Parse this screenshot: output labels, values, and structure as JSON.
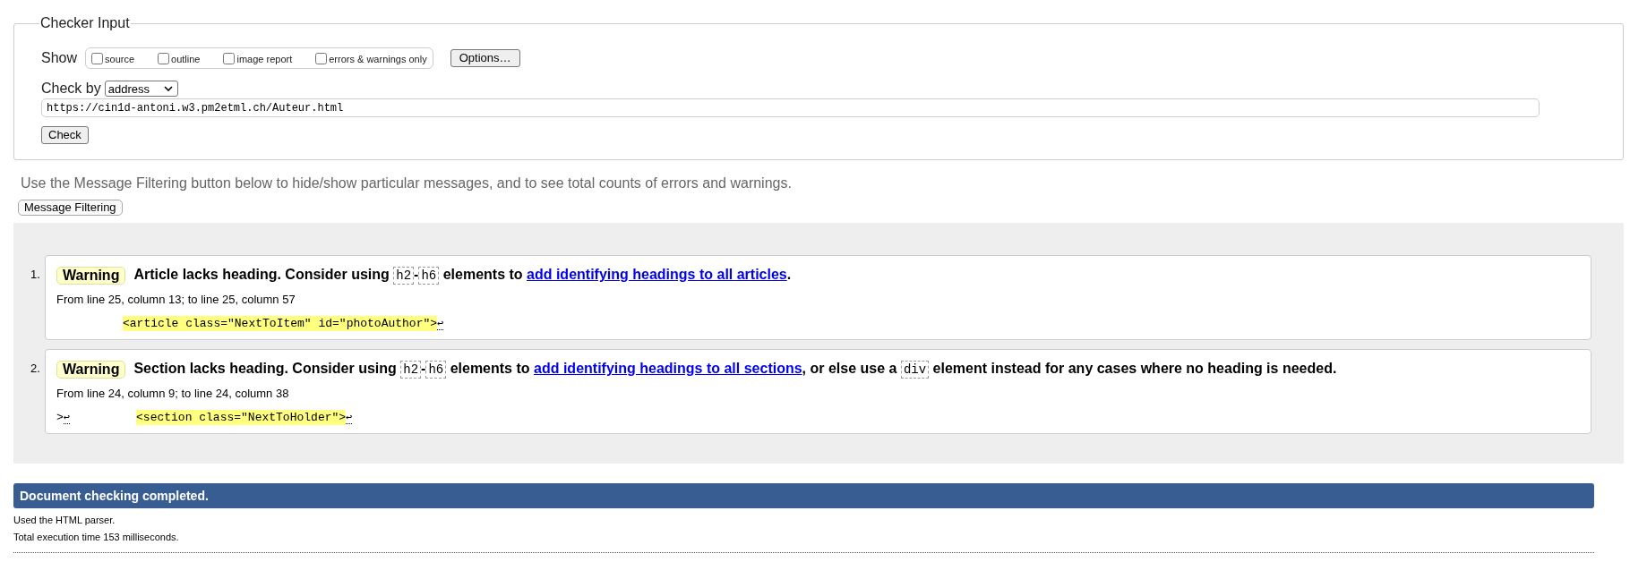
{
  "checker_input": {
    "legend": "Checker Input",
    "show": {
      "label": "Show",
      "options": [
        {
          "label": "source",
          "checked": false
        },
        {
          "label": "outline",
          "checked": false
        },
        {
          "label": "image report",
          "checked": false
        },
        {
          "label": "errors & warnings only",
          "checked": false
        }
      ]
    },
    "options_button": "Options…",
    "check_by": {
      "label": "Check by",
      "value": "address"
    },
    "url": {
      "value": "https://cin1d-antoni.w3.pm2etml.ch/Auteur.html"
    },
    "check_button": "Check"
  },
  "filtering_hint": "Use the Message Filtering button below to hide/show particular messages, and to see total counts of errors and warnings.",
  "filtering_button": "Message Filtering",
  "messages": [
    {
      "number": "1.",
      "kind": "warning",
      "badge": "Warning",
      "message": [
        {
          "kind": "text",
          "text": "Article lacks heading. Consider using "
        },
        {
          "kind": "code",
          "text": "h2"
        },
        {
          "kind": "text",
          "text": "-"
        },
        {
          "kind": "code",
          "text": "h6"
        },
        {
          "kind": "text",
          "text": " elements to "
        },
        {
          "kind": "link",
          "text": "add identifying headings to all articles"
        },
        {
          "kind": "text",
          "text": "."
        }
      ],
      "location": "From line 25, column 13; to line 25, column 57",
      "extract": [
        {
          "kind": "indent"
        },
        {
          "kind": "highlight",
          "text": "<article class=\"NextToItem\" id=\"photoAuthor\">"
        },
        {
          "kind": "linebreak",
          "text": "↩"
        }
      ]
    },
    {
      "number": "2.",
      "kind": "warning",
      "badge": "Warning",
      "message": [
        {
          "kind": "text",
          "text": "Section lacks heading. Consider using "
        },
        {
          "kind": "code",
          "text": "h2"
        },
        {
          "kind": "text",
          "text": "-"
        },
        {
          "kind": "code",
          "text": "h6"
        },
        {
          "kind": "text",
          "text": " elements to "
        },
        {
          "kind": "link",
          "text": "add identifying headings to all sections"
        },
        {
          "kind": "text",
          "text": ", or else use a "
        },
        {
          "kind": "code",
          "text": "div"
        },
        {
          "kind": "text",
          "text": " element instead for any cases where no heading is needed."
        }
      ],
      "location": "From line 24, column 9; to line 24, column 38",
      "extract": [
        {
          "kind": "text",
          "text": ">"
        },
        {
          "kind": "linebreak",
          "text": "↩"
        },
        {
          "kind": "indent"
        },
        {
          "kind": "highlight",
          "text": "<section class=\"NextToHolder\">"
        },
        {
          "kind": "linebreak",
          "text": "↩"
        }
      ]
    }
  ],
  "status": {
    "title": "Document checking completed.",
    "details": [
      "Used the HTML parser.",
      "Total execution time 153 milliseconds."
    ]
  }
}
